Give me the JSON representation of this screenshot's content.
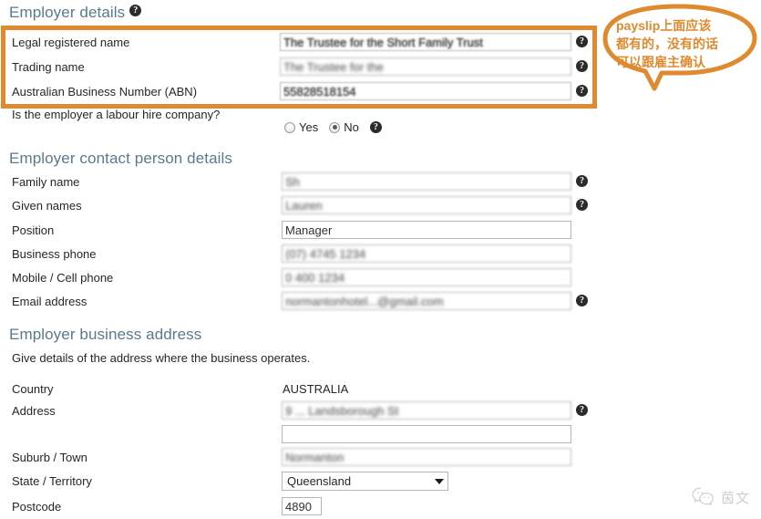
{
  "sections": {
    "employer_details": {
      "heading": "Employer details",
      "help_icon": "question-mark-icon",
      "rows": [
        {
          "label": "Legal registered name",
          "value": "The Trustee for the Short Family Trust",
          "help": true
        },
        {
          "label": "Trading name",
          "value": "The Trustee for the",
          "help": true
        },
        {
          "label": "Australian Business Number (ABN)",
          "value": "55828518154",
          "help": true
        }
      ],
      "labour_hire": {
        "question": "Is the employer a labour hire company?",
        "options": [
          "Yes",
          "No"
        ],
        "selected": "No",
        "help": true
      }
    },
    "contact_person": {
      "heading": "Employer contact person details",
      "rows": [
        {
          "label": "Family name",
          "value": "Sh",
          "help": true
        },
        {
          "label": "Given names",
          "value": "Lauren",
          "help": true
        },
        {
          "label": "Position",
          "value": "Manager",
          "help": false
        },
        {
          "label": "Business phone",
          "value": "(07) 4745 1234",
          "help": false
        },
        {
          "label": "Mobile / Cell phone",
          "value": "0 400 1234",
          "help": false
        },
        {
          "label": "Email address",
          "value": "normantonhotel...@gmail.com",
          "help": true
        }
      ]
    },
    "business_address": {
      "heading": "Employer business address",
      "subtext": "Give details of the address where the business operates.",
      "country": {
        "label": "Country",
        "value": "AUSTRALIA"
      },
      "address": {
        "label": "Address",
        "line1": "9 ... Landsborough St",
        "line2": "",
        "help": true
      },
      "suburb": {
        "label": "Suburb / Town",
        "value": "Normanton"
      },
      "state": {
        "label": "State / Territory",
        "value": "Queensland",
        "caret": "chevron-down-icon"
      },
      "postcode": {
        "label": "Postcode",
        "value": "4890"
      }
    }
  },
  "annotation": {
    "bubble_lines": [
      "payslip上面应该",
      "都有的，没有的话",
      "可以跟雇主确认"
    ],
    "color": "#e08a30"
  },
  "highlight": {
    "color": "#e08a30"
  },
  "watermark": {
    "icon": "wechat-icon",
    "label": "茵文"
  }
}
